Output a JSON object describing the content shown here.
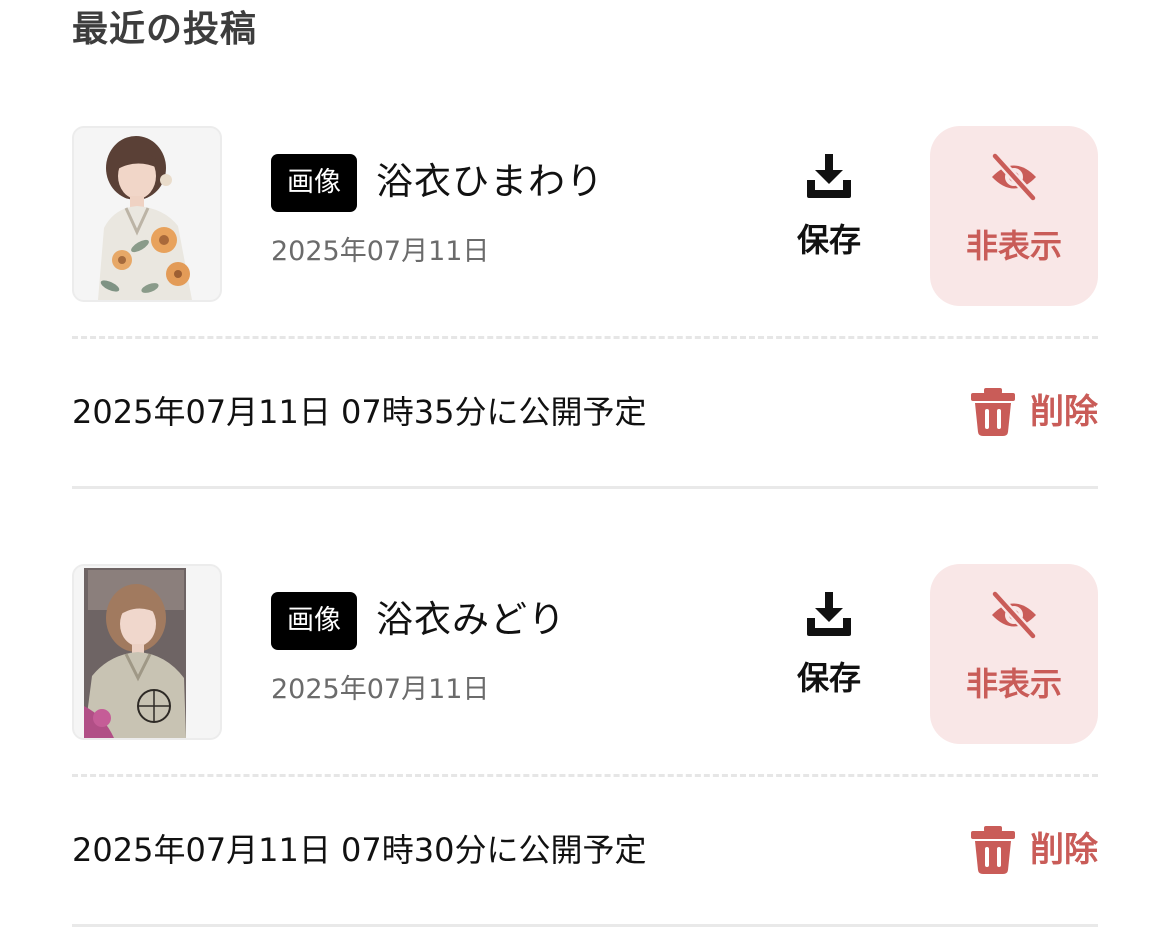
{
  "section": {
    "title": "最近の投稿"
  },
  "posts": [
    {
      "type_badge": "画像",
      "title": "浴衣ひまわり",
      "date": "2025年07月11日",
      "save_label": "保存",
      "hide_label": "非表示",
      "schedule": "2025年07月11日 07時35分に公開予定",
      "delete_label": "削除"
    },
    {
      "type_badge": "画像",
      "title": "浴衣みどり",
      "date": "2025年07月11日",
      "save_label": "保存",
      "hide_label": "非表示",
      "schedule": "2025年07月11日 07時30分に公開予定",
      "delete_label": "削除"
    }
  ],
  "colors": {
    "accent_red": "#c95c58",
    "hide_button_bg": "#f9e7e7",
    "badge_bg": "#000000"
  },
  "icons": {
    "save": "download-tray-icon",
    "hide": "eye-slash-icon",
    "delete": "trash-icon"
  }
}
